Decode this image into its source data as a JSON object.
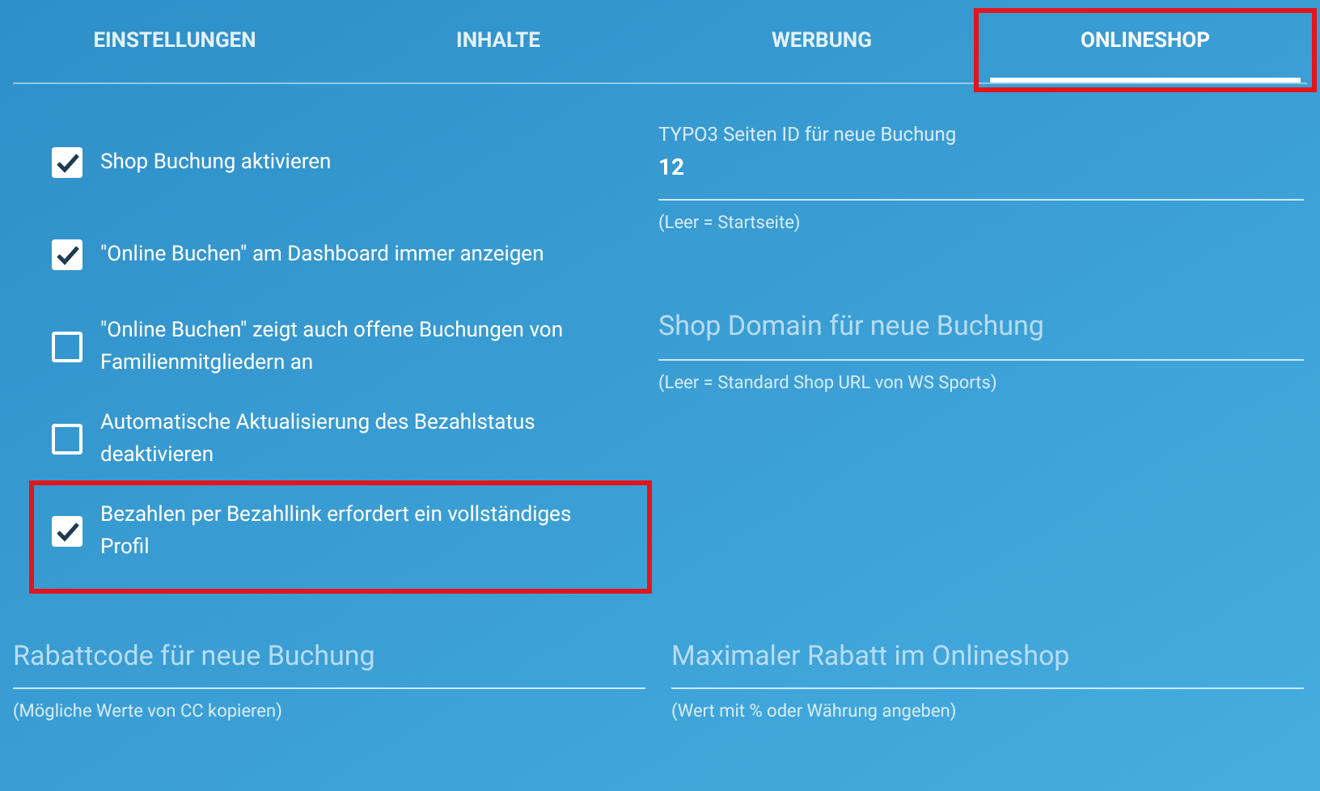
{
  "tabs": [
    {
      "label": "EINSTELLUNGEN",
      "selected": false,
      "highlighted": false
    },
    {
      "label": "INHALTE",
      "selected": false,
      "highlighted": false
    },
    {
      "label": "WERBUNG",
      "selected": false,
      "highlighted": false
    },
    {
      "label": "ONLINESHOP",
      "selected": true,
      "highlighted": true
    }
  ],
  "options": [
    {
      "label": "Shop Buchung aktivieren",
      "checked": true,
      "highlighted": false
    },
    {
      "label": "\"Online Buchen\" am Dashboard immer anzeigen",
      "checked": true,
      "highlighted": false
    },
    {
      "label": "\"Online Buchen\" zeigt auch offene Buchungen von Familienmitgliedern an",
      "checked": false,
      "highlighted": false
    },
    {
      "label": "Automatische Aktualisierung des Bezahlstatus deaktivieren",
      "checked": false,
      "highlighted": false
    },
    {
      "label": "Bezahlen per Bezahllink erfordert ein vollständiges Profil",
      "checked": true,
      "highlighted": true
    }
  ],
  "right_fields": [
    {
      "label": "TYPO3 Seiten ID für neue Buchung",
      "value": "12",
      "hint": "(Leer = Startseite)"
    },
    {
      "placeholder": "Shop Domain für neue Buchung",
      "hint": "(Leer = Standard Shop URL von WS Sports)"
    }
  ],
  "bottom_fields": [
    {
      "placeholder": "Rabattcode für neue Buchung",
      "hint": "(Mögliche Werte von CC kopieren)"
    },
    {
      "placeholder": "Maximaler Rabatt im Onlineshop",
      "hint": "(Wert mit % oder Währung angeben)"
    }
  ]
}
